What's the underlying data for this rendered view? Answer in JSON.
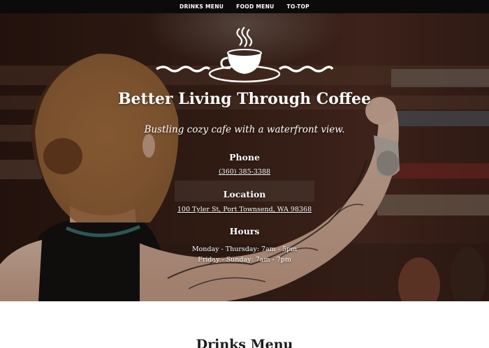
{
  "nav": {
    "items": [
      {
        "label": "DRINKS MENU"
      },
      {
        "label": "FOOD MENU"
      },
      {
        "label": "TO-TOP"
      }
    ]
  },
  "hero": {
    "logo_icon": "coffee-cup-waves-logo",
    "headline": "Better Living Through Coffee",
    "tagline": "Bustling cozy cafe with a waterfront view.",
    "phone": {
      "heading": "Phone",
      "value": "(360) 385-3388"
    },
    "location": {
      "heading": "Location",
      "value": "100 Tyler St, Port Townsend, WA 98368"
    },
    "hours": {
      "heading": "Hours",
      "weekday": "Monday - Thursday: 7am - 5pm",
      "weekend": "Friday - Sunday: 7am - 7pm"
    }
  },
  "drinks_section": {
    "title": "Drinks Menu"
  },
  "colors": {
    "nav_bg": "#0b0b0b",
    "text_light": "#ffffff",
    "text_dark": "#1c1c1c",
    "page_bg": "#ffffff"
  }
}
